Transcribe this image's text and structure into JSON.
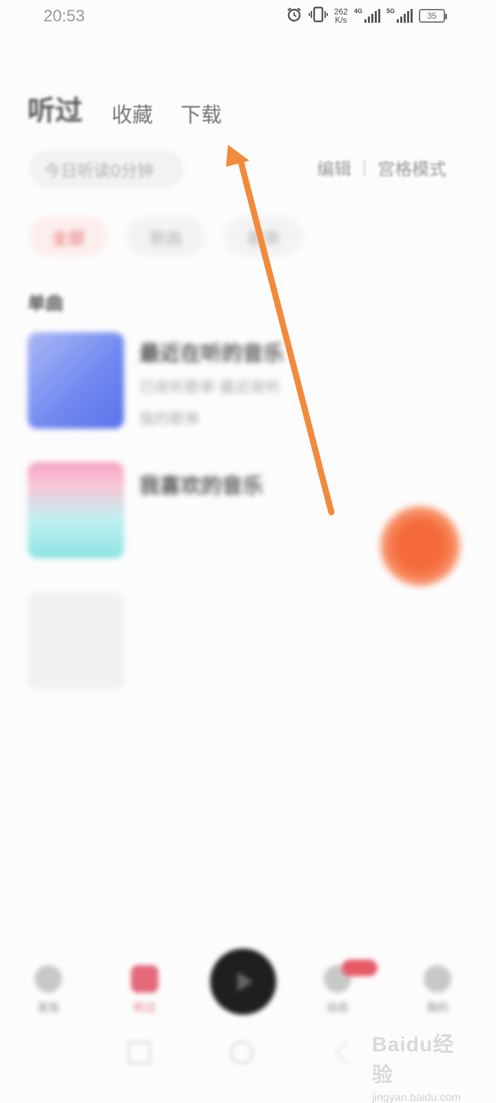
{
  "status_bar": {
    "time": "20:53",
    "speed_value": "262",
    "speed_unit": "K/s",
    "net_4g": "4G",
    "net_5g": "5G",
    "battery": "35",
    "icons": [
      "alarm-icon",
      "vibrate-icon",
      "signal-icon",
      "battery-icon"
    ]
  },
  "tabs": {
    "active": "听过",
    "items": [
      "收藏",
      "下载"
    ]
  },
  "listen_time": "今日听读0分钟",
  "actions": {
    "edit": "编辑",
    "grid": "宫格模式"
  },
  "chips": [
    "全部",
    "歌曲",
    "歌单"
  ],
  "section_title": "单曲",
  "items": [
    {
      "title": "最近在听的音乐",
      "sub1": "已收听歌单·最近收听",
      "sub2": "我的歌单"
    },
    {
      "title": "我喜欢的音乐"
    }
  ],
  "bottom_nav": {
    "items": [
      "发现",
      "听过",
      "",
      "动态",
      "我的"
    ]
  },
  "annotation": {
    "color": "#f28a3c"
  },
  "watermark": {
    "main": "Baidu经验",
    "sub": "jingyan.baidu.com"
  }
}
